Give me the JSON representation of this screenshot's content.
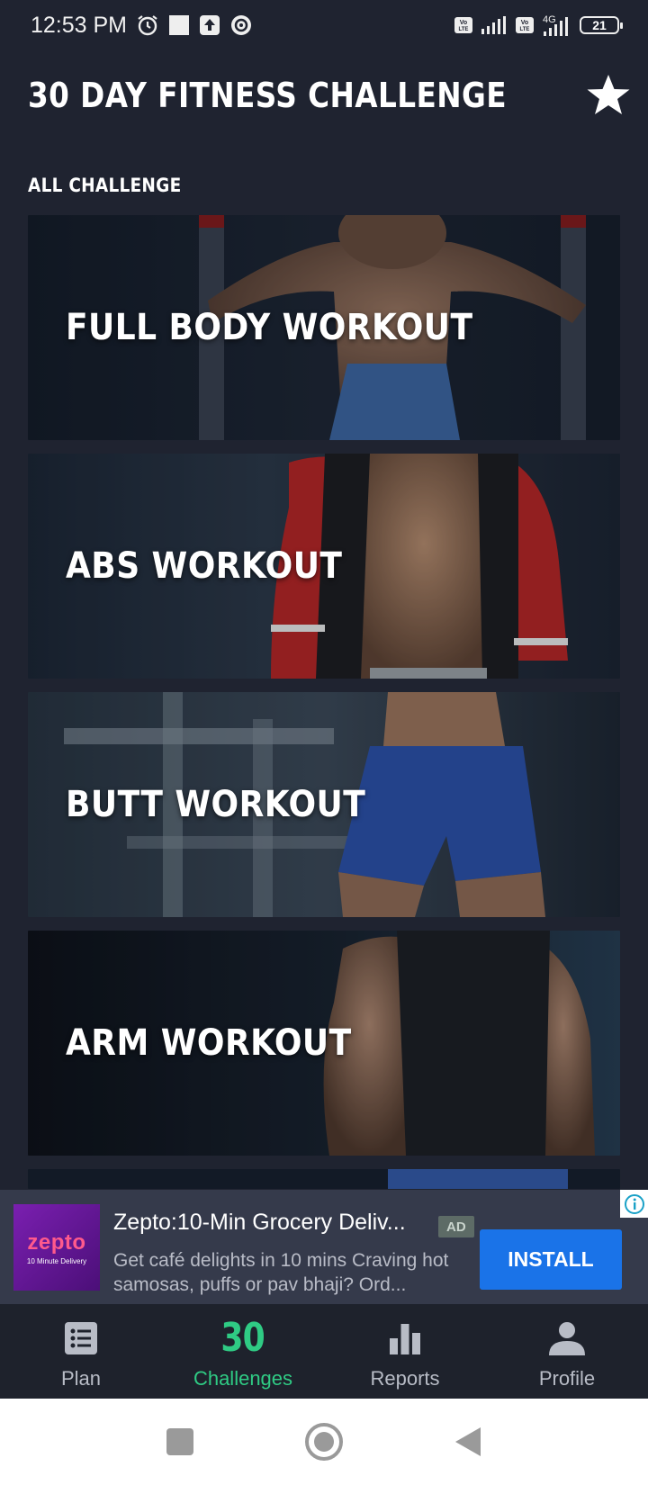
{
  "status_bar": {
    "time": "12:53 PM",
    "battery": "21",
    "icons": [
      "alarm-icon",
      "square-notification-icon",
      "upload-icon",
      "vpn-icon",
      "volte-icon",
      "signal-icon",
      "4g-icon",
      "battery-icon"
    ]
  },
  "header": {
    "title": "30 DAY FITNESS CHALLENGE",
    "action_icon": "star-icon"
  },
  "section": {
    "label": "ALL CHALLENGE"
  },
  "cards": [
    {
      "title": "FULL BODY WORKOUT"
    },
    {
      "title": "ABS WORKOUT"
    },
    {
      "title": "BUTT WORKOUT"
    },
    {
      "title": "ARM WORKOUT"
    }
  ],
  "ad": {
    "logo_text": "zepto",
    "logo_subtext": "10 Minute Delivery",
    "title": "Zepto:10-Min Grocery Deliv...",
    "badge": "AD",
    "description": "Get café delights in 10 mins Craving hot samosas, puffs or pav bhaji? Ord...",
    "button": "INSTALL",
    "info_icon": "info-icon"
  },
  "bottom_nav": {
    "items": [
      {
        "label": "Plan",
        "icon": "list-icon",
        "active": false
      },
      {
        "label": "Challenges",
        "icon_text": "30",
        "active": true
      },
      {
        "label": "Reports",
        "icon": "bar-chart-icon",
        "active": false
      },
      {
        "label": "Profile",
        "icon": "person-icon",
        "active": false
      }
    ]
  },
  "colors": {
    "background": "#1f2330",
    "accent": "#2fcb84",
    "install_button": "#1a73e8",
    "ad_background": "#353a4b"
  }
}
